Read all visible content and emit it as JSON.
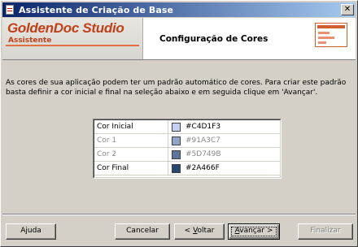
{
  "window": {
    "title": "Assistente de Criação de Base",
    "close_glyph": "✕"
  },
  "banner": {
    "logo_text": "GoldenDoc Studio",
    "logo_subtext": "Assistente",
    "page_title": "Configuração de Cores"
  },
  "description": "As cores de sua aplicação podem ter um padrão automático de cores. Para criar este padrão basta definir a cor inicial e final na seleção abaixo e em seguida clique em 'Avançar'.",
  "colors": [
    {
      "label": "Cor Inicial",
      "hex": "#C4D1F3",
      "swatch": "#C4D1F3",
      "enabled": true
    },
    {
      "label": "Cor 1",
      "hex": "#91A3C7",
      "swatch": "#91A3C7",
      "enabled": false
    },
    {
      "label": "Cor 2",
      "hex": "#5D749B",
      "swatch": "#5D749B",
      "enabled": false
    },
    {
      "label": "Cor Final",
      "hex": "#2A466F",
      "swatch": "#2A466F",
      "enabled": true
    }
  ],
  "buttons": {
    "help": "Ajuda",
    "cancel": "Cancelar",
    "back_prefix": "< ",
    "back_ul": "V",
    "back_rest": "oltar",
    "next_ul": "A",
    "next_rest": "vançar >",
    "finish": "Finalizar"
  },
  "theme": {
    "titlebar_start": "#0a246a",
    "titlebar_end": "#a6caf0",
    "brand": "#c0401a"
  }
}
